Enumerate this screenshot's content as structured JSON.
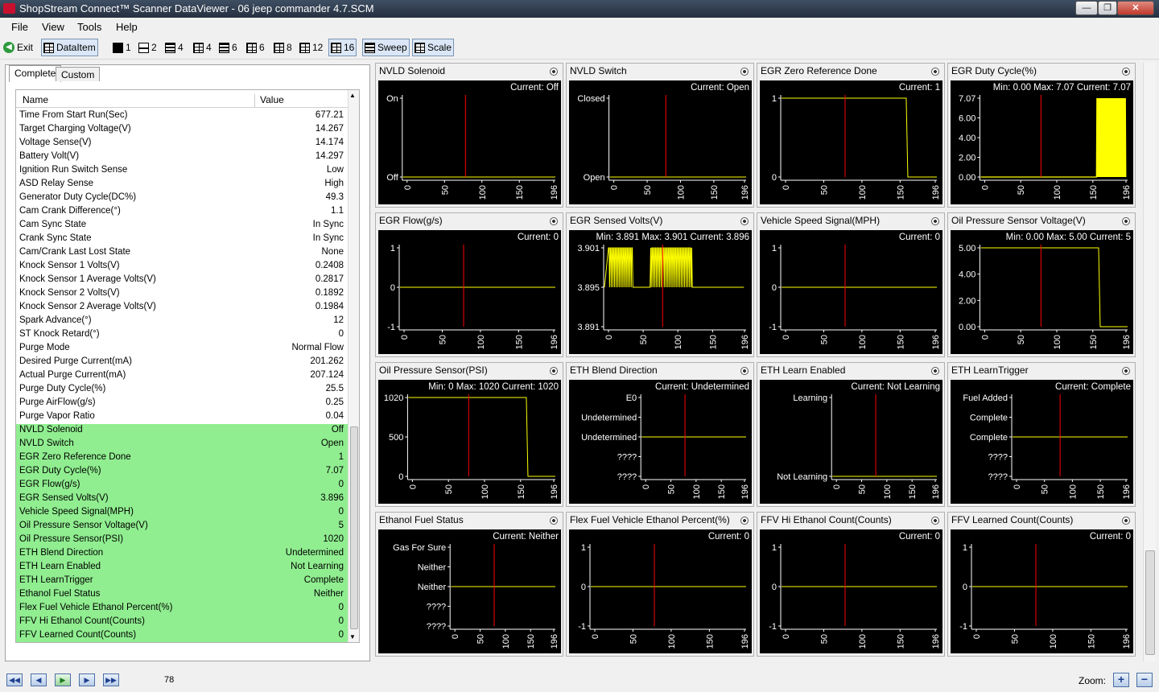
{
  "window": {
    "title": "ShopStream Connect™ Scanner DataViewer - 06 jeep commander 4.7.SCM",
    "minimize": "—",
    "maximize": "❐",
    "close": "✕"
  },
  "menu": [
    "File",
    "View",
    "Tools",
    "Help"
  ],
  "toolbar": {
    "exit": "Exit",
    "dataitem": "DataItem",
    "layouts": [
      "1",
      "2",
      "4",
      "4",
      "6",
      "6",
      "8",
      "12",
      "16"
    ],
    "sweep": "Sweep",
    "scale": "Scale"
  },
  "tabs": [
    "Complete",
    "Custom"
  ],
  "table": {
    "columns": [
      "Name",
      "Value"
    ],
    "rows": [
      [
        "Time From Start Run(Sec)",
        "677.21"
      ],
      [
        "Target Charging Voltage(V)",
        "14.267"
      ],
      [
        "Voltage Sense(V)",
        "14.174"
      ],
      [
        "Battery Volt(V)",
        "14.297"
      ],
      [
        "Ignition Run Switch Sense",
        "Low"
      ],
      [
        "ASD Relay Sense",
        "High"
      ],
      [
        "Generator Duty Cycle(DC%)",
        "49.3"
      ],
      [
        "Cam Crank Difference(°)",
        "1.1"
      ],
      [
        "Cam Sync State",
        "In Sync"
      ],
      [
        "Crank Sync State",
        "In Sync"
      ],
      [
        "Cam/Crank Last Lost State",
        "None"
      ],
      [
        "Knock Sensor 1 Volts(V)",
        "0.2408"
      ],
      [
        "Knock Sensor 1 Average Volts(V)",
        "0.2817"
      ],
      [
        "Knock Sensor 2 Volts(V)",
        "0.1892"
      ],
      [
        "Knock Sensor 2 Average Volts(V)",
        "0.1984"
      ],
      [
        "Spark Advance(°)",
        "12"
      ],
      [
        "ST Knock Retard(°)",
        "0"
      ],
      [
        "Purge Mode",
        "Normal Flow"
      ],
      [
        "Desired Purge Current(mA)",
        "201.262"
      ],
      [
        "Actual Purge Current(mA)",
        "207.124"
      ],
      [
        "Purge Duty Cycle(%)",
        "25.5"
      ],
      [
        "Purge AirFlow(g/s)",
        "0.25"
      ],
      [
        "Purge Vapor Ratio",
        "0.04"
      ],
      [
        "NVLD Solenoid",
        "Off"
      ],
      [
        "NVLD Switch",
        "Open"
      ],
      [
        "EGR Zero Reference Done",
        "1"
      ],
      [
        "EGR Duty Cycle(%)",
        "7.07"
      ],
      [
        "EGR Flow(g/s)",
        "0"
      ],
      [
        "EGR Sensed Volts(V)",
        "3.896"
      ],
      [
        "Vehicle Speed Signal(MPH)",
        "0"
      ],
      [
        "Oil Pressure Sensor Voltage(V)",
        "5"
      ],
      [
        "Oil Pressure Sensor(PSI)",
        "1020"
      ],
      [
        "ETH Blend Direction",
        "Undetermined"
      ],
      [
        "ETH Learn Enabled",
        "Not Learning"
      ],
      [
        "ETH LearnTrigger",
        "Complete"
      ],
      [
        "Ethanol Fuel Status",
        "Neither"
      ],
      [
        "Flex Fuel Vehicle Ethanol Percent(%)",
        "0"
      ],
      [
        "FFV Hi Ethanol Count(Counts)",
        "0"
      ],
      [
        "FFV Learned Count(Counts)",
        "0"
      ]
    ],
    "highlight_from": 23,
    "highlight_color": "#90ee90"
  },
  "x_ticks": [
    "0",
    "50",
    "100",
    "150",
    "196"
  ],
  "cursor_frame": 78,
  "panels": [
    {
      "title": "NVLD Solenoid",
      "info": "Current: Off",
      "y": [
        "On",
        "Off"
      ],
      "trace": "flat"
    },
    {
      "title": "NVLD Switch",
      "info": "Current: Open",
      "y": [
        "Closed",
        "Open"
      ],
      "trace": "flat"
    },
    {
      "title": "EGR Zero Reference Done",
      "info": "Current: 1",
      "y": [
        "1",
        "0"
      ],
      "trace": "highdrop"
    },
    {
      "title": "EGR Duty Cycle(%)",
      "info": "Min: 0.00     Max: 7.07     Current: 7.07",
      "y": [
        "7.07",
        "6.00",
        "4.00",
        "2.00",
        "0.00"
      ],
      "trace": "lowburst"
    },
    {
      "title": "EGR Flow(g/s)",
      "info": "Current: 0",
      "y": [
        "1",
        "0",
        "-1"
      ],
      "trace": "flat"
    },
    {
      "title": "EGR Sensed Volts(V)",
      "info": "Min: 3.891     Max: 3.901     Current: 3.896",
      "y": [
        "3.901",
        "3.895",
        "3.891"
      ],
      "trace": "noisy"
    },
    {
      "title": "Vehicle Speed Signal(MPH)",
      "info": "Current: 0",
      "y": [
        "1",
        "0",
        "-1"
      ],
      "trace": "flat"
    },
    {
      "title": "Oil Pressure Sensor Voltage(V)",
      "info": "Min: 0.00     Max: 5.00     Current: 5",
      "y": [
        "5.00",
        "4.00",
        "2.00",
        "0.00"
      ],
      "trace": "highdrop"
    },
    {
      "title": "Oil Pressure Sensor(PSI)",
      "info": "Min: 0     Max: 1020     Current: 1020",
      "y": [
        "1020",
        "500",
        "0"
      ],
      "trace": "highdrop"
    },
    {
      "title": "ETH Blend Direction",
      "info": "Current: Undetermined",
      "y": [
        "E0",
        "Undetermined",
        "Undetermined",
        "????",
        "????"
      ],
      "trace": "flat"
    },
    {
      "title": "ETH Learn Enabled",
      "info": "Current: Not Learning",
      "y": [
        "Learning",
        "Not Learning"
      ],
      "trace": "flat"
    },
    {
      "title": "ETH LearnTrigger",
      "info": "Current: Complete",
      "y": [
        "Fuel Added",
        "Complete",
        "Complete",
        "????",
        "????"
      ],
      "trace": "flat"
    },
    {
      "title": "Ethanol Fuel Status",
      "info": "Current: Neither",
      "y": [
        "Gas For Sure",
        "Neither",
        "Neither",
        "????",
        "????"
      ],
      "trace": "flat"
    },
    {
      "title": "Flex Fuel Vehicle Ethanol Percent(%)",
      "info": "Current: 0",
      "y": [
        "1",
        "0",
        "-1"
      ],
      "trace": "flat"
    },
    {
      "title": "FFV Hi Ethanol Count(Counts)",
      "info": "Current: 0",
      "y": [
        "1",
        "0",
        "-1"
      ],
      "trace": "flat"
    },
    {
      "title": "FFV Learned Count(Counts)",
      "info": "Current: 0",
      "y": [
        "1",
        "0",
        "-1"
      ],
      "trace": "flat"
    }
  ],
  "status": {
    "frame": "78",
    "zoom": "Zoom:",
    "zoom_in": "+",
    "zoom_out": "−"
  },
  "colors": {
    "plot_bg": "#000000",
    "trace": "#ffff00",
    "cursor": "#ff0000",
    "axis": "#ffffff"
  }
}
